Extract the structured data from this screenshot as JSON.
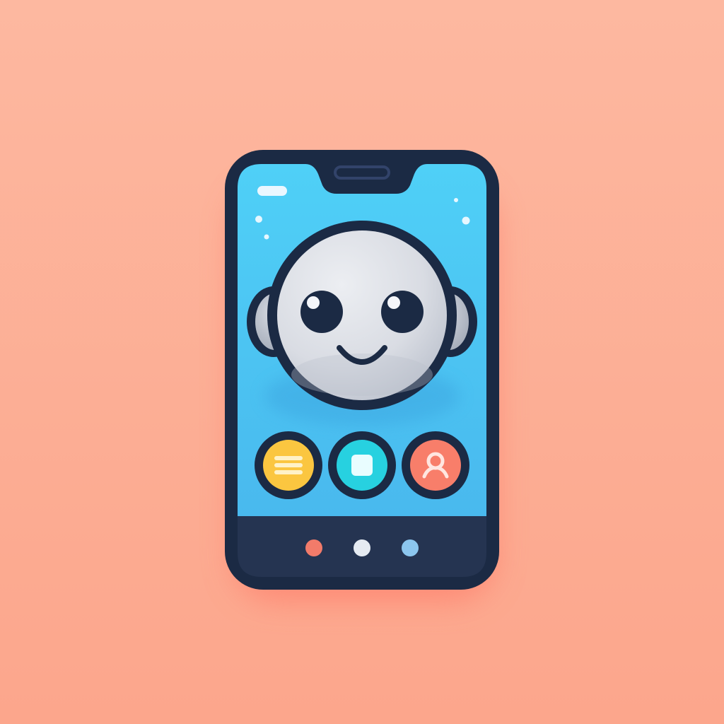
{
  "colors": {
    "background_top": "#FDB8A0",
    "background_bottom": "#FCA68C",
    "shadow": "#FF6F5E",
    "phone_frame": "#1B2A44",
    "screen_top": "#4FD0F7",
    "screen_bottom": "#49B9EE",
    "bottom_bar": "#253451",
    "robot_face": "#D9DCE3",
    "robot_face_shade": "#B9BFCB",
    "button_menu": "#FBC640",
    "button_stop": "#27D1E0",
    "button_user": "#F87E6A",
    "nav_dot_1": "#F27B6A",
    "nav_dot_2": "#E5EBF2",
    "nav_dot_3": "#8CC6EE"
  },
  "icons": {
    "menu_button": "menu-icon",
    "stop_button": "stop-icon",
    "user_button": "user-icon"
  }
}
